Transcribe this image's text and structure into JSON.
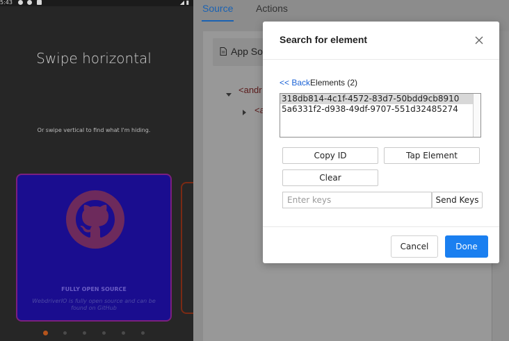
{
  "device": {
    "status_time": "5:43",
    "status_right": "◢ ▮",
    "title": "Swipe horizontal",
    "subtitle": "Or swipe vertical to find what I'm hiding.",
    "card": {
      "title": "FULLY OPEN SOURCE",
      "text": "WebdriverIO is fully open source and can be found on GitHub"
    },
    "dots_active_index": 0
  },
  "inspector": {
    "tabs": [
      {
        "label": "Source"
      },
      {
        "label": "Actions"
      }
    ],
    "source_title": "App So",
    "tree": [
      {
        "text": "<andr"
      },
      {
        "text": "<a"
      }
    ]
  },
  "modal": {
    "title": "Search for element",
    "back_label": "<< Back",
    "elements_label": "Elements (2)",
    "elements": [
      {
        "id": "318db814-4c1f-4572-83d7-50bdd9cb8910",
        "selected": true
      },
      {
        "id": "5a6331f2-d938-49df-9707-551d32485274",
        "selected": false
      }
    ],
    "copy_id_label": "Copy ID",
    "tap_element_label": "Tap Element",
    "clear_label": "Clear",
    "keys_placeholder": "Enter keys",
    "send_keys_label": "Send Keys",
    "cancel_label": "Cancel",
    "done_label": "Done"
  },
  "colors": {
    "primary": "#1a7ff0",
    "link": "#1a62d6",
    "tab_active": "#1a62b3",
    "card_bg": "#1a0d8f",
    "device_bg": "#262626"
  }
}
